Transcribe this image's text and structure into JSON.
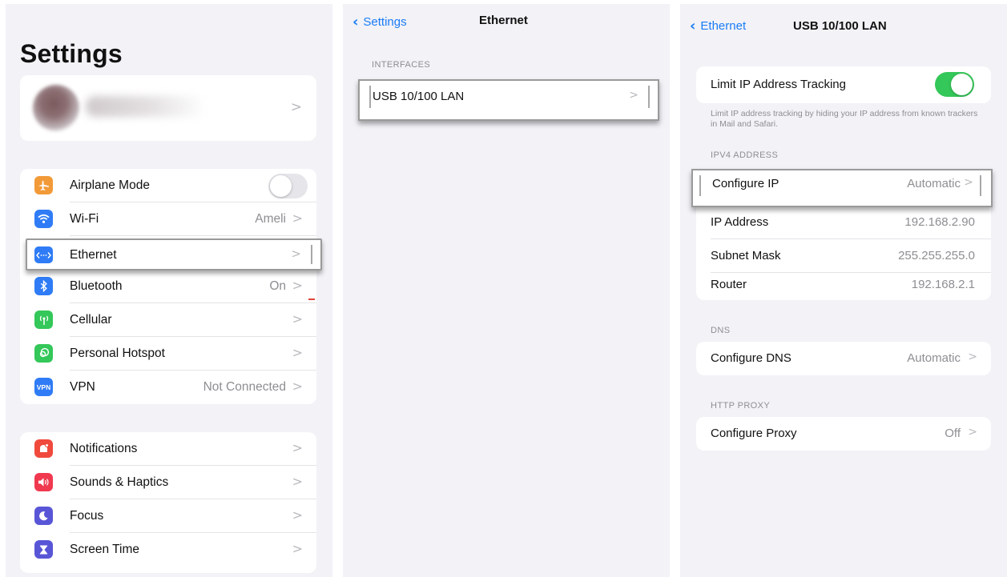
{
  "panel_settings": {
    "title": "Settings",
    "profile": {
      "chevron": ">"
    },
    "group1": [
      {
        "label": "Airplane Mode",
        "value": "",
        "icon": "airplane-icon",
        "color": "#f29a38",
        "glyph": "✈"
      },
      {
        "label": "Wi-Fi",
        "value": "Ameli",
        "icon": "wifi-icon",
        "color": "#2f7cf6",
        "glyph": "≋"
      },
      {
        "label": "Ethernet",
        "value": "",
        "icon": "ethernet-icon",
        "color": "#2f7cf6",
        "glyph": "‹··›"
      },
      {
        "label": "Bluetooth",
        "value": "On",
        "icon": "bluetooth-icon",
        "color": "#2f7cf6",
        "glyph": "ᛒ"
      },
      {
        "label": "Cellular",
        "value": "",
        "icon": "cellular-icon",
        "color": "#34c759",
        "glyph": "((·))"
      },
      {
        "label": "Personal Hotspot",
        "value": "",
        "icon": "hotspot-icon",
        "color": "#34c759",
        "glyph": "⊛"
      },
      {
        "label": "VPN",
        "value": "Not Connected",
        "icon": "vpn-icon",
        "color": "#2f7cf6",
        "glyph": "VPN"
      }
    ],
    "group2": [
      {
        "label": "Notifications",
        "icon": "notifications-icon",
        "color": "#f04a3d",
        "glyph": "▣"
      },
      {
        "label": "Sounds & Haptics",
        "icon": "sounds-icon",
        "color": "#f0394f",
        "glyph": "◀)"
      },
      {
        "label": "Focus",
        "icon": "focus-icon",
        "color": "#5856d6",
        "glyph": "☾"
      },
      {
        "label": "Screen Time",
        "icon": "screen-time-icon",
        "color": "#5856d6",
        "glyph": "⧗"
      }
    ],
    "airplane_mode_on": false
  },
  "panel_ethernet": {
    "back_label": "Settings",
    "title": "Ethernet",
    "section": "INTERFACES",
    "interface": "USB 10/100 LAN"
  },
  "panel_usb": {
    "back_label": "Ethernet",
    "title": "USB 10/100 LAN",
    "limit_tracking_label": "Limit IP Address Tracking",
    "limit_tracking_on": true,
    "limit_tracking_note": "Limit IP address tracking by hiding your IP address from known trackers in Mail and Safari.",
    "ipv4_section": "IPV4 ADDRESS",
    "configure_ip_label": "Configure IP",
    "configure_ip_value": "Automatic",
    "ip_address_label": "IP Address",
    "ip_address_value": "192.168.2.90",
    "subnet_label": "Subnet Mask",
    "subnet_value": "255.255.255.0",
    "router_label": "Router",
    "router_value": "192.168.2.1",
    "dns_section": "DNS",
    "configure_dns_label": "Configure DNS",
    "configure_dns_value": "Automatic",
    "proxy_section": "HTTP PROXY",
    "configure_proxy_label": "Configure Proxy",
    "configure_proxy_value": "Off"
  },
  "colors": {
    "accent_blue": "#1a7cf5",
    "toggle_green": "#34c759",
    "toggle_off": "#e5e5ea",
    "background": "#f2f2f7"
  }
}
